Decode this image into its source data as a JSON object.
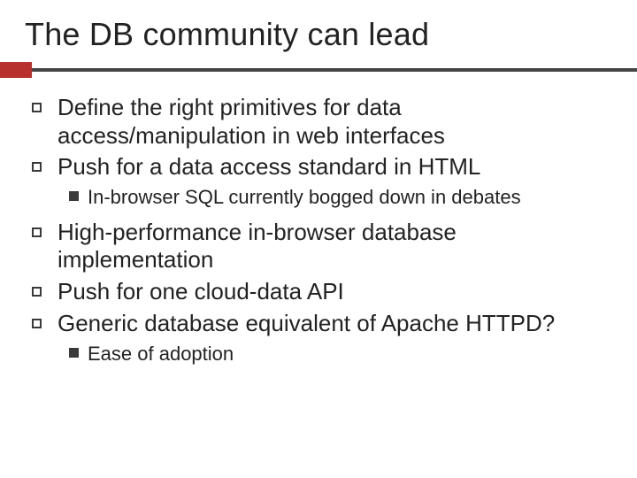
{
  "title": "The DB community can lead",
  "bullets": {
    "b0": "Define the right primitives for data access/manipulation in web interfaces",
    "b1": "Push for a data access standard in HTML",
    "b1_sub0": "In-browser SQL currently bogged down in debates",
    "b2": "High-performance in-browser database implementation",
    "b3": "Push for one cloud-data API",
    "b4": "Generic database equivalent of Apache HTTPD?",
    "b4_sub0": "Ease of adoption"
  },
  "colors": {
    "accent": "#b7302e",
    "rule": "#444444"
  }
}
